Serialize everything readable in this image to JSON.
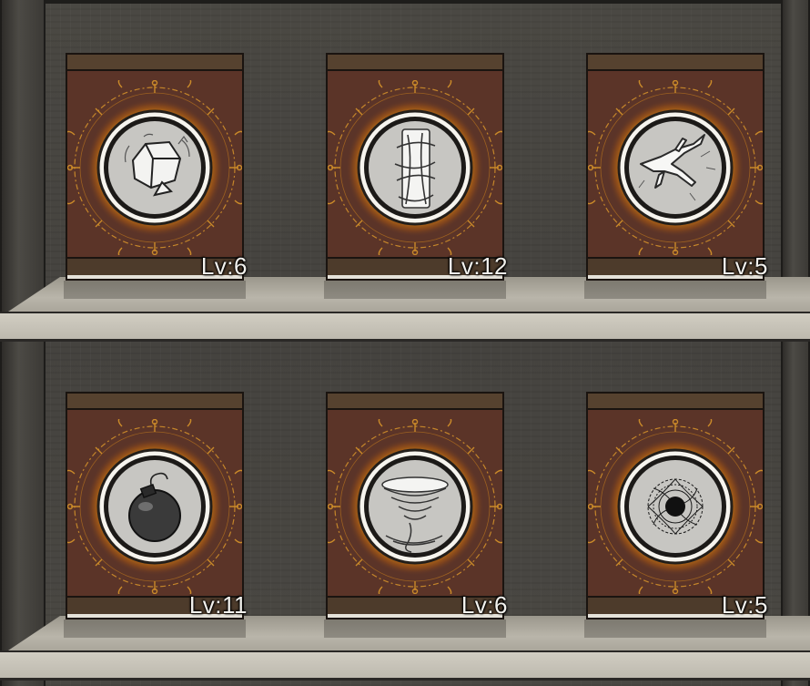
{
  "books": [
    {
      "id": "rock",
      "icon": "rock-icon",
      "level": "Lv:6"
    },
    {
      "id": "tornado-column",
      "icon": "wind-column-icon",
      "level": "Lv:12"
    },
    {
      "id": "lightning",
      "icon": "lightning-icon",
      "level": "Lv:5"
    },
    {
      "id": "bomb",
      "icon": "bomb-icon",
      "level": "Lv:11"
    },
    {
      "id": "whirlwind",
      "icon": "whirlwind-icon",
      "level": "Lv:6"
    },
    {
      "id": "black-hole",
      "icon": "black-hole-icon",
      "level": "Lv:5"
    }
  ],
  "colors": {
    "cover": "#5b3428",
    "glow": "#f2a81d",
    "level_text": "#f2f1ed"
  }
}
